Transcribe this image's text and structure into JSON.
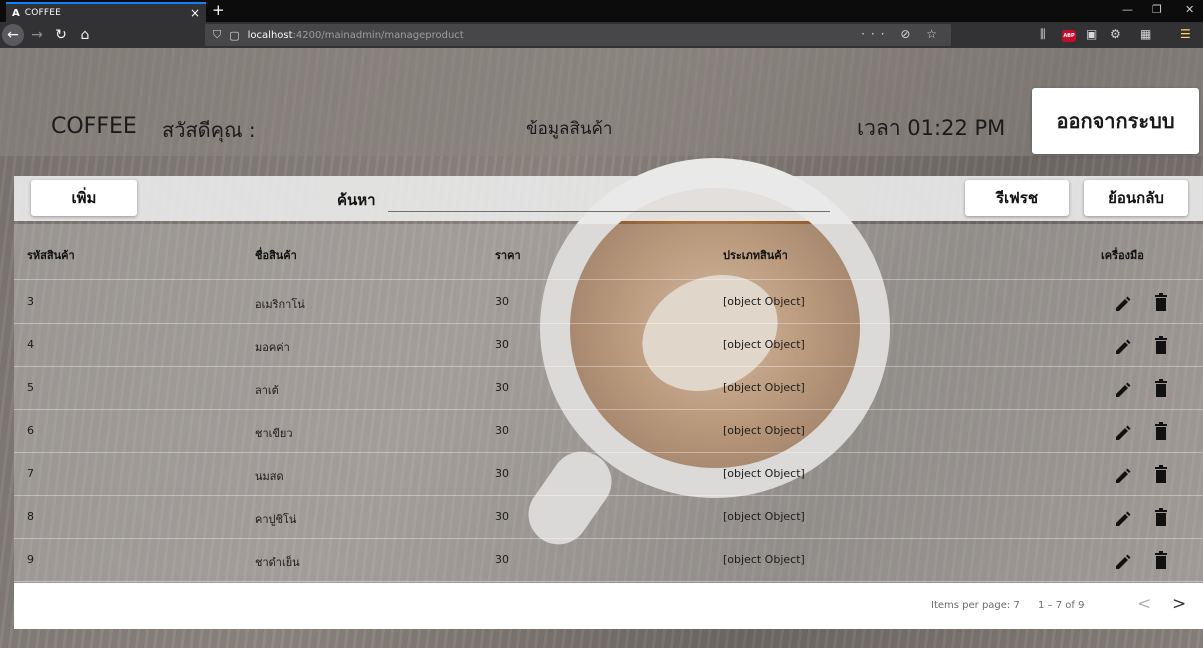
{
  "browser": {
    "tab_title": "COFFEE",
    "tab_favicon": "A",
    "url_host": "localhost",
    "url_path": ":4200/mainadmin/manageproduct",
    "page_actions": "··· ⊘ ☆"
  },
  "header": {
    "logo": "COFFEE",
    "greeting": "สวัสดีคุณ :",
    "title": "ข้อมูลสินค้า",
    "clock": "เวลา 01:22 PM",
    "logout_label": "ออกจากระบบ"
  },
  "toolbar": {
    "add_label": "เพิ่ม",
    "search_label": "ค้นหา",
    "search_value": "",
    "refresh_label": "รีเฟรช",
    "back_label": "ย้อนกลับ"
  },
  "table": {
    "columns": [
      "รหัสสินค้า",
      "ชื่อสินค้า",
      "ราคา",
      "ประเภทสินค้า",
      "เครื่องมือ"
    ],
    "rows": [
      {
        "id": "3",
        "name": "อเมริกาโน่",
        "price": "30",
        "type": "[object Object]"
      },
      {
        "id": "4",
        "name": "มอคค่า",
        "price": "30",
        "type": "[object Object]"
      },
      {
        "id": "5",
        "name": "ลาเต้",
        "price": "30",
        "type": "[object Object]"
      },
      {
        "id": "6",
        "name": "ชาเขียว",
        "price": "30",
        "type": "[object Object]"
      },
      {
        "id": "7",
        "name": "นมสด",
        "price": "30",
        "type": "[object Object]"
      },
      {
        "id": "8",
        "name": "คาปูชิโน่",
        "price": "30",
        "type": "[object Object]"
      },
      {
        "id": "9",
        "name": "ชาดำเย็น",
        "price": "30",
        "type": "[object Object]"
      }
    ]
  },
  "paginator": {
    "items_per_page": "Items per page: 7",
    "range": "1 – 7 of 9"
  }
}
